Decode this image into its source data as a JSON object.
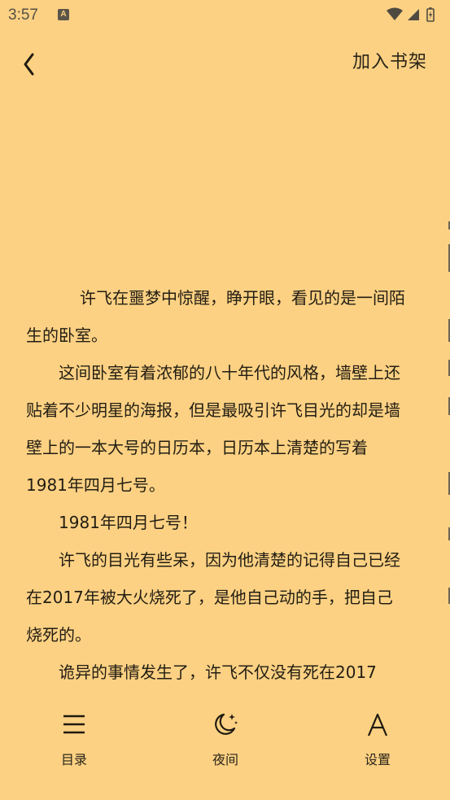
{
  "status_bar": {
    "time": "3:57",
    "notification_icon_letter": "A",
    "icons": [
      "wifi-icon",
      "signal-icon",
      "battery-icon"
    ]
  },
  "top_bar": {
    "back_icon": "chevron-left-icon",
    "add_to_shelf_label": "加入书架"
  },
  "content": {
    "paragraphs": [
      "许飞在噩梦中惊醒，睁开眼，看见的是一间陌生的卧室。",
      "这间卧室有着浓郁的八十年代的风格，墙壁上还贴着不少明星的海报，但是最吸引许飞目光的却是墙壁上的一本大号的日历本，日历本上清楚的写着1981年四月七号。",
      "1981年四月七号！",
      "许飞的目光有些呆，因为他清楚的记得自己已经在2017年被大火烧死了，是他自己动的手，把自己烧死的。",
      "诡异的事情发生了，许飞不仅没有死在2017"
    ]
  },
  "bottom_bar": {
    "catalog_label": "目录",
    "night_label": "夜间",
    "settings_label": "设置",
    "catalog_icon": "menu-icon",
    "night_icon": "moon-icon",
    "settings_icon": "font-a-icon"
  },
  "colors": {
    "background": "#fcd183",
    "text": "#221d13"
  }
}
